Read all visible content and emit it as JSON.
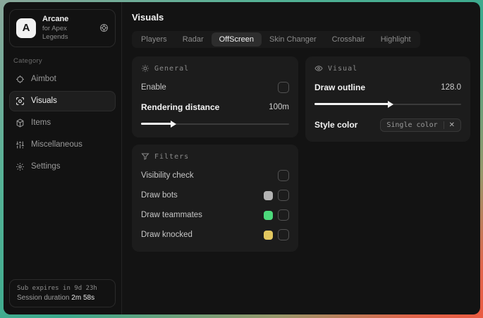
{
  "sidebar": {
    "logo": {
      "letter": "A",
      "title": "Arcane",
      "subtitle": "for Apex Legends"
    },
    "category_label": "Category",
    "items": [
      {
        "label": "Aimbot",
        "icon": "crosshair-icon",
        "selected": false
      },
      {
        "label": "Visuals",
        "icon": "eye-scan-icon",
        "selected": true
      },
      {
        "label": "Items",
        "icon": "box-icon",
        "selected": false
      },
      {
        "label": "Miscellaneous",
        "icon": "sliders-icon",
        "selected": false
      },
      {
        "label": "Settings",
        "icon": "gear-icon",
        "selected": false
      }
    ],
    "status": {
      "line1": "Sub expires in 9d 23h",
      "line2_label": "Session duration",
      "line2_value": "2m 58s"
    }
  },
  "header": {
    "title": "Visuals"
  },
  "tabs": [
    {
      "label": "Players",
      "selected": false
    },
    {
      "label": "Radar",
      "selected": false
    },
    {
      "label": "OffScreen",
      "selected": true
    },
    {
      "label": "Skin Changer",
      "selected": false
    },
    {
      "label": "Crosshair",
      "selected": false
    },
    {
      "label": "Highlight",
      "selected": false
    }
  ],
  "panels": {
    "general": {
      "title": "General",
      "enable_label": "Enable",
      "enable_checked": false,
      "rendering_label": "Rendering distance",
      "rendering_value": "100m",
      "rendering_percent": 21
    },
    "visual": {
      "title": "Visual",
      "outline_label": "Draw outline",
      "outline_value": "128.0",
      "outline_percent": 51,
      "style_label": "Style color",
      "style_value": "Single color",
      "style_remove": "✕"
    },
    "filters": {
      "title": "Filters",
      "rows": [
        {
          "label": "Visibility check",
          "swatch": null,
          "checked": false
        },
        {
          "label": "Draw bots",
          "swatch": "#b3b3b3",
          "checked": false
        },
        {
          "label": "Draw teammates",
          "swatch": "#4cd97b",
          "checked": false
        },
        {
          "label": "Draw knocked",
          "swatch": "#e2c75f",
          "checked": false
        }
      ]
    }
  },
  "colors": {
    "accent_teal": "#3aa98c",
    "accent_orange": "#ea5b41",
    "window_bg": "#131313",
    "panel_bg": "#1c1c1c",
    "swatch_gray": "#b3b3b3",
    "swatch_green": "#4cd97b",
    "swatch_yellow": "#e2c75f"
  }
}
